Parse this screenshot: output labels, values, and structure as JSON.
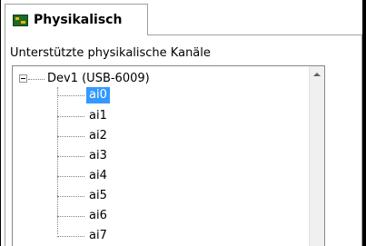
{
  "tab": {
    "icon": "daq-device-icon",
    "label": "Physikalisch"
  },
  "group": {
    "label": "Unterstützte physikalische Kanäle"
  },
  "tree": {
    "root_label": "Dev1  (USB-6009)",
    "expanded": true,
    "children": [
      {
        "label": "ai0",
        "selected": true
      },
      {
        "label": "ai1",
        "selected": false
      },
      {
        "label": "ai2",
        "selected": false
      },
      {
        "label": "ai3",
        "selected": false
      },
      {
        "label": "ai4",
        "selected": false
      },
      {
        "label": "ai5",
        "selected": false
      },
      {
        "label": "ai6",
        "selected": false
      },
      {
        "label": "ai7",
        "selected": false
      }
    ]
  },
  "colors": {
    "selection": "#3399ff",
    "tab_icon": "#1d6a25"
  }
}
